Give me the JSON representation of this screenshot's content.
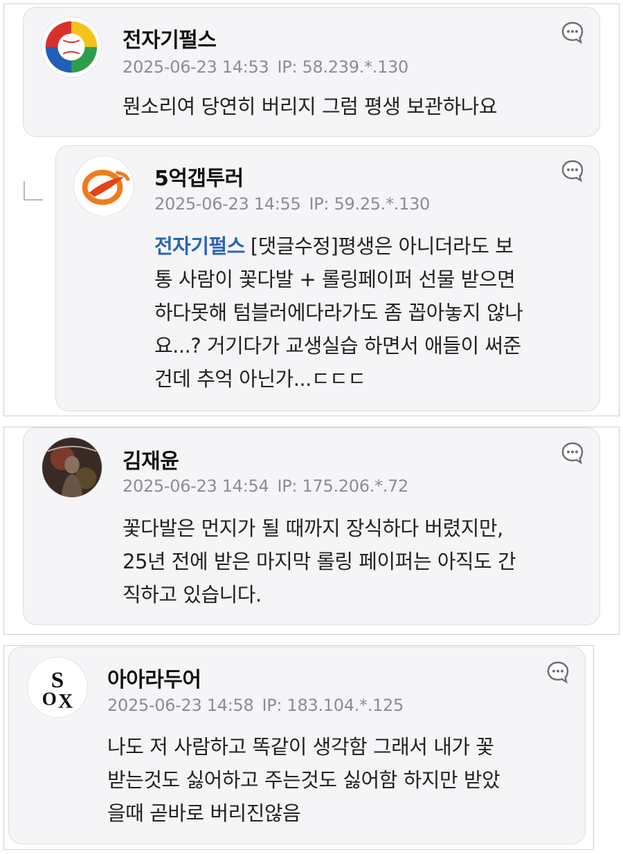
{
  "comments": [
    {
      "nickname": "전자기펄스",
      "date": "2025-06-23 14:53",
      "ip": "IP: 58.239.*.130",
      "lines": [
        "뭔소리여 당연히 버리지 그럼 평생 보관하나요"
      ],
      "avatar_icon": "baseball-logo-icon"
    },
    {
      "nickname": "5억갭투러",
      "date": "2025-06-23 14:55",
      "ip": "IP: 59.25.*.130",
      "mention": "전자기펄스",
      "lines": [
        "[댓글수정]평생은 아니더라도 보",
        "통 사람이 꽃다발 + 롤링페이퍼 선물 받으면",
        "하다못해 텀블러에다라가도 좀 꼽아놓지 않나",
        "요...? 거기다가 교생실습 하면서 애들이 써준",
        "건데 추억 아닌가...ㄷㄷㄷ"
      ],
      "avatar_icon": "orange-swoosh-logo-icon"
    },
    {
      "nickname": "김재윤",
      "date": "2025-06-23 14:54",
      "ip": "IP: 175.206.*.72",
      "lines": [
        "꽃다발은 먼지가 될 때까지 장식하다 버렸지만,",
        "25년 전에 받은 마지막 롤링 페이퍼는 아직도 간",
        "직하고 있습니다."
      ],
      "avatar_icon": "dark-photo-avatar-icon"
    },
    {
      "nickname": "아아라두어",
      "date": "2025-06-23 14:58",
      "ip": "IP: 183.104.*.125",
      "lines": [
        "나도 저 사람하고 똑같이 생각함 그래서 내가 꽃",
        "받는것도 싫어하고 주는것도 싫어함 하지만 받았",
        "을때 곧바로 버리진않음"
      ],
      "avatar_icon": "white-sox-logo-icon"
    }
  ],
  "colors": {
    "mention": "#2a63b8",
    "meta": "#8c8c92",
    "card_bg": "#f5f5f8"
  }
}
